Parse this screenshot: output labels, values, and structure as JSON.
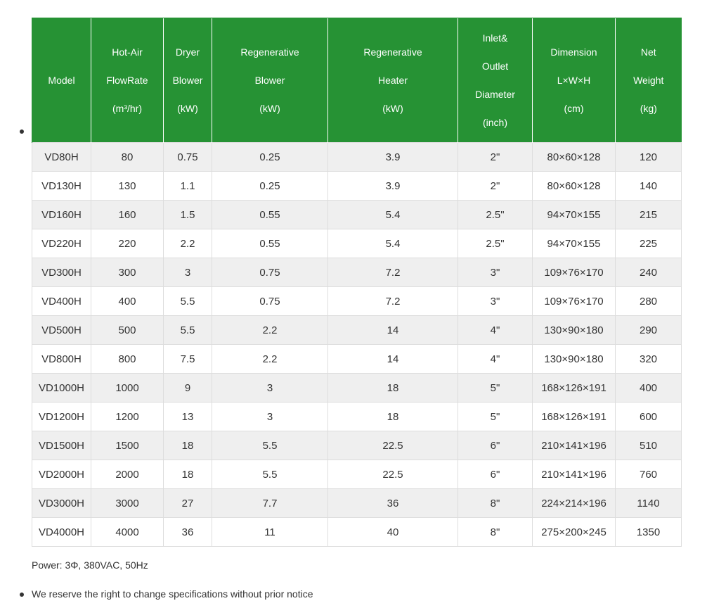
{
  "table": {
    "headers": [
      {
        "lines": [
          "Model"
        ]
      },
      {
        "lines": [
          "Hot-Air",
          "FlowRate",
          "(m³/hr)"
        ]
      },
      {
        "lines": [
          "Dryer",
          "Blower",
          "(kW)"
        ]
      },
      {
        "lines": [
          "Regenerative",
          "Blower",
          "(kW)"
        ]
      },
      {
        "lines": [
          "Regenerative",
          "Heater",
          "(kW)"
        ]
      },
      {
        "lines": [
          "Inlet&",
          "Outlet",
          "Diameter",
          "(inch)"
        ]
      },
      {
        "lines": [
          "Dimension",
          "L×W×H",
          "(cm)"
        ]
      },
      {
        "lines": [
          "Net",
          "Weight",
          "(kg)"
        ]
      }
    ],
    "rows": [
      [
        "VD80H",
        "80",
        "0.75",
        "0.25",
        "3.9",
        "2\"",
        "80×60×128",
        "120"
      ],
      [
        "VD130H",
        "130",
        "1.1",
        "0.25",
        "3.9",
        "2\"",
        "80×60×128",
        "140"
      ],
      [
        "VD160H",
        "160",
        "1.5",
        "0.55",
        "5.4",
        "2.5\"",
        "94×70×155",
        "215"
      ],
      [
        "VD220H",
        "220",
        "2.2",
        "0.55",
        "5.4",
        "2.5\"",
        "94×70×155",
        "225"
      ],
      [
        "VD300H",
        "300",
        "3",
        "0.75",
        "7.2",
        "3\"",
        "109×76×170",
        "240"
      ],
      [
        "VD400H",
        "400",
        "5.5",
        "0.75",
        "7.2",
        "3\"",
        "109×76×170",
        "280"
      ],
      [
        "VD500H",
        "500",
        "5.5",
        "2.2",
        "14",
        "4\"",
        "130×90×180",
        "290"
      ],
      [
        "VD800H",
        "800",
        "7.5",
        "2.2",
        "14",
        "4\"",
        "130×90×180",
        "320"
      ],
      [
        "VD1000H",
        "1000",
        "9",
        "3",
        "18",
        "5\"",
        "168×126×191",
        "400"
      ],
      [
        "VD1200H",
        "1200",
        "13",
        "3",
        "18",
        "5\"",
        "168×126×191",
        "600"
      ],
      [
        "VD1500H",
        "1500",
        "18",
        "5.5",
        "22.5",
        "6\"",
        "210×141×196",
        "510"
      ],
      [
        "VD2000H",
        "2000",
        "18",
        "5.5",
        "22.5",
        "6\"",
        "210×141×196",
        "760"
      ],
      [
        "VD3000H",
        "3000",
        "27",
        "7.7",
        "36",
        "8\"",
        "224×214×196",
        "1140"
      ],
      [
        "VD4000H",
        "4000",
        "36",
        "11",
        "40",
        "8\"",
        "275×200×245",
        "1350"
      ]
    ]
  },
  "power_note": "Power: 3Φ, 380VAC, 50Hz",
  "notice": "We reserve the right to change specifications without prior notice",
  "colors": {
    "header_bg": "#269234",
    "stripe": "#efefef"
  }
}
